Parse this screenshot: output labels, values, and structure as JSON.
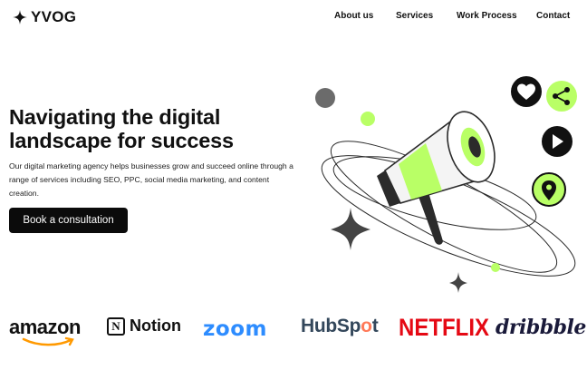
{
  "nav": {
    "logo_text": "YVOG",
    "links": [
      "About us",
      "Services",
      "Work Process",
      "Contact"
    ]
  },
  "hero": {
    "title": "Navigating the digital landscape for success",
    "description": "Our digital marketing agency helps businesses grow and succeed online through a range of services including SEO, PPC, social media marketing, and content creation.",
    "cta_label": "Book a consultation"
  },
  "brands": {
    "amazon": "amazon",
    "notion": "Notion",
    "notion_mark": "N",
    "zoom": "zoom",
    "hubspot_a": "HubSp",
    "hubspot_o": "o",
    "hubspot_b": "t",
    "netflix": "NETFLIX",
    "dribbble": "dribbble"
  },
  "colors": {
    "accent": "#b9ff66",
    "dark": "#191a23",
    "zoom": "#2d8cff",
    "netflix": "#e50914",
    "hubspot": "#ff7a59"
  },
  "icons": [
    "star-logo-icon",
    "heart-icon",
    "share-icon",
    "play-icon",
    "location-pin-icon",
    "megaphone-illustration"
  ]
}
